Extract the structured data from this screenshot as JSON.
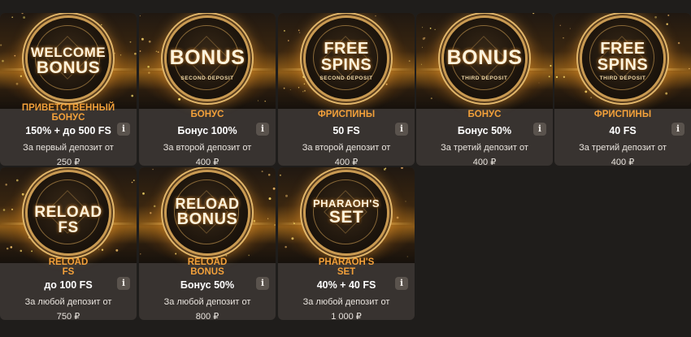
{
  "bonuses": [
    {
      "medal_lines": [
        "WELCOME",
        "BONUS"
      ],
      "medal_sub": "",
      "label": "ПРИВЕТСТВЕННЫЙ БОНУС",
      "value": "150% + до 500 FS",
      "desc_line1": "За первый депозит от",
      "desc_line2": "250 ₽",
      "info": "i"
    },
    {
      "medal_lines": [
        "BONUS"
      ],
      "medal_sub": "SECOND DEPOSIT",
      "label": "БОНУС",
      "value": "Бонус 100%",
      "desc_line1": "За второй депозит от",
      "desc_line2": "400 ₽",
      "info": "i"
    },
    {
      "medal_lines": [
        "FREE",
        "SPINS"
      ],
      "medal_sub": "SECOND DEPOSIT",
      "label": "ФРИСПИНЫ",
      "value": "50 FS",
      "desc_line1": "За второй депозит от",
      "desc_line2": "400 ₽",
      "info": "i"
    },
    {
      "medal_lines": [
        "BONUS"
      ],
      "medal_sub": "THIRD DEPOSIT",
      "label": "БОНУС",
      "value": "Бонус 50%",
      "desc_line1": "За третий депозит от",
      "desc_line2": "400 ₽",
      "info": "i"
    },
    {
      "medal_lines": [
        "FREE",
        "SPINS"
      ],
      "medal_sub": "THIRD DEPOSIT",
      "label": "ФРИСПИНЫ",
      "value": "40 FS",
      "desc_line1": "За третий депозит от",
      "desc_line2": "400 ₽",
      "info": "i"
    },
    {
      "medal_lines": [
        "RELOAD FS"
      ],
      "medal_sub": "",
      "label_line1": "RELOAD",
      "label_line2": "FS",
      "value": "до 100 FS",
      "desc_line1": "За любой депозит от",
      "desc_line2": "750 ₽",
      "info": "i"
    },
    {
      "medal_lines": [
        "RELOAD",
        "BONUS"
      ],
      "medal_sub": "",
      "label_line1": "RELOAD",
      "label_line2": "BONUS",
      "value": "Бонус 50%",
      "desc_line1": "За любой депозит от",
      "desc_line2": "800 ₽",
      "info": "i"
    },
    {
      "medal_lines": [
        "PHARAOH'S",
        "SET"
      ],
      "medal_sub": "",
      "label_line1": "PHARAOH'S",
      "label_line2": "SET",
      "value": "40% + 40 FS",
      "desc_line1": "За любой депозит от",
      "desc_line2": "1 000 ₽",
      "info": "i"
    }
  ],
  "colors": {
    "background": "#1f1d1b",
    "card": "#383330",
    "accent": "#f2a03a",
    "gold": "#e0b56a"
  },
  "icons": {
    "info_button": "info-icon"
  }
}
